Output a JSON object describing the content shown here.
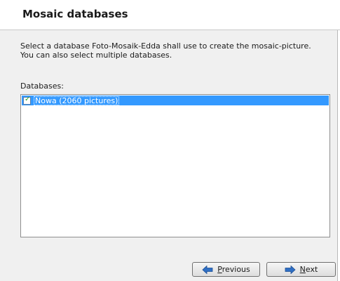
{
  "header": {
    "title": "Mosaic databases"
  },
  "instructions": {
    "line1": "Select a database Foto-Mosaik-Edda shall use to create the mosaic-picture.",
    "line2": "You can also select multiple databases."
  },
  "databases": {
    "label": "Databases:",
    "items": [
      {
        "label": "Nowa (2060 pictures)",
        "checked": true,
        "selected": true
      }
    ]
  },
  "buttons": {
    "previous": {
      "mnemonic": "P",
      "rest": "revious",
      "icon": "arrow-left-icon"
    },
    "next": {
      "mnemonic": "N",
      "rest": "ext",
      "icon": "arrow-right-icon"
    }
  },
  "colors": {
    "selection": "#3399ff",
    "arrow": "#2f6fc4"
  }
}
